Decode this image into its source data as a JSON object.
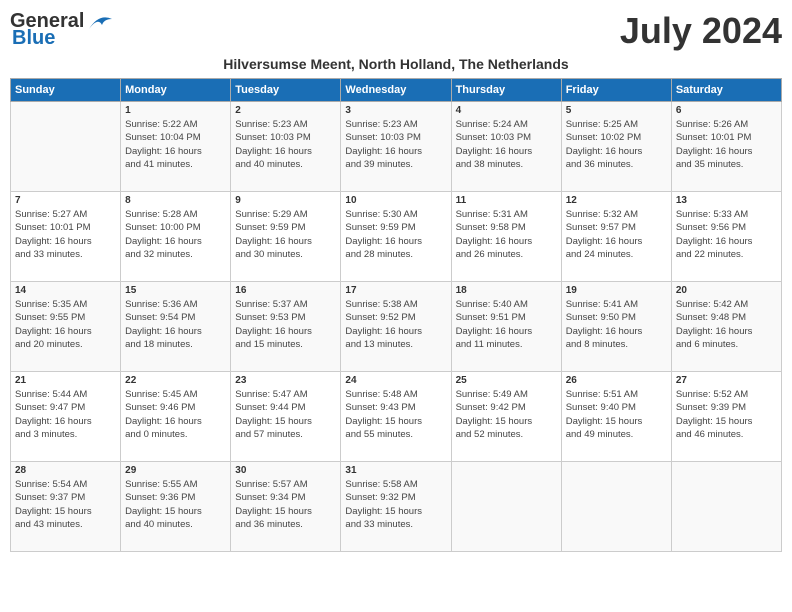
{
  "header": {
    "logo_line1": "General",
    "logo_line2": "Blue",
    "month_year": "July 2024",
    "location": "Hilversumse Meent, North Holland, The Netherlands"
  },
  "days_of_week": [
    "Sunday",
    "Monday",
    "Tuesday",
    "Wednesday",
    "Thursday",
    "Friday",
    "Saturday"
  ],
  "weeks": [
    [
      {
        "day": "",
        "info": ""
      },
      {
        "day": "1",
        "info": "Sunrise: 5:22 AM\nSunset: 10:04 PM\nDaylight: 16 hours\nand 41 minutes."
      },
      {
        "day": "2",
        "info": "Sunrise: 5:23 AM\nSunset: 10:03 PM\nDaylight: 16 hours\nand 40 minutes."
      },
      {
        "day": "3",
        "info": "Sunrise: 5:23 AM\nSunset: 10:03 PM\nDaylight: 16 hours\nand 39 minutes."
      },
      {
        "day": "4",
        "info": "Sunrise: 5:24 AM\nSunset: 10:03 PM\nDaylight: 16 hours\nand 38 minutes."
      },
      {
        "day": "5",
        "info": "Sunrise: 5:25 AM\nSunset: 10:02 PM\nDaylight: 16 hours\nand 36 minutes."
      },
      {
        "day": "6",
        "info": "Sunrise: 5:26 AM\nSunset: 10:01 PM\nDaylight: 16 hours\nand 35 minutes."
      }
    ],
    [
      {
        "day": "7",
        "info": "Sunrise: 5:27 AM\nSunset: 10:01 PM\nDaylight: 16 hours\nand 33 minutes."
      },
      {
        "day": "8",
        "info": "Sunrise: 5:28 AM\nSunset: 10:00 PM\nDaylight: 16 hours\nand 32 minutes."
      },
      {
        "day": "9",
        "info": "Sunrise: 5:29 AM\nSunset: 9:59 PM\nDaylight: 16 hours\nand 30 minutes."
      },
      {
        "day": "10",
        "info": "Sunrise: 5:30 AM\nSunset: 9:59 PM\nDaylight: 16 hours\nand 28 minutes."
      },
      {
        "day": "11",
        "info": "Sunrise: 5:31 AM\nSunset: 9:58 PM\nDaylight: 16 hours\nand 26 minutes."
      },
      {
        "day": "12",
        "info": "Sunrise: 5:32 AM\nSunset: 9:57 PM\nDaylight: 16 hours\nand 24 minutes."
      },
      {
        "day": "13",
        "info": "Sunrise: 5:33 AM\nSunset: 9:56 PM\nDaylight: 16 hours\nand 22 minutes."
      }
    ],
    [
      {
        "day": "14",
        "info": "Sunrise: 5:35 AM\nSunset: 9:55 PM\nDaylight: 16 hours\nand 20 minutes."
      },
      {
        "day": "15",
        "info": "Sunrise: 5:36 AM\nSunset: 9:54 PM\nDaylight: 16 hours\nand 18 minutes."
      },
      {
        "day": "16",
        "info": "Sunrise: 5:37 AM\nSunset: 9:53 PM\nDaylight: 16 hours\nand 15 minutes."
      },
      {
        "day": "17",
        "info": "Sunrise: 5:38 AM\nSunset: 9:52 PM\nDaylight: 16 hours\nand 13 minutes."
      },
      {
        "day": "18",
        "info": "Sunrise: 5:40 AM\nSunset: 9:51 PM\nDaylight: 16 hours\nand 11 minutes."
      },
      {
        "day": "19",
        "info": "Sunrise: 5:41 AM\nSunset: 9:50 PM\nDaylight: 16 hours\nand 8 minutes."
      },
      {
        "day": "20",
        "info": "Sunrise: 5:42 AM\nSunset: 9:48 PM\nDaylight: 16 hours\nand 6 minutes."
      }
    ],
    [
      {
        "day": "21",
        "info": "Sunrise: 5:44 AM\nSunset: 9:47 PM\nDaylight: 16 hours\nand 3 minutes."
      },
      {
        "day": "22",
        "info": "Sunrise: 5:45 AM\nSunset: 9:46 PM\nDaylight: 16 hours\nand 0 minutes."
      },
      {
        "day": "23",
        "info": "Sunrise: 5:47 AM\nSunset: 9:44 PM\nDaylight: 15 hours\nand 57 minutes."
      },
      {
        "day": "24",
        "info": "Sunrise: 5:48 AM\nSunset: 9:43 PM\nDaylight: 15 hours\nand 55 minutes."
      },
      {
        "day": "25",
        "info": "Sunrise: 5:49 AM\nSunset: 9:42 PM\nDaylight: 15 hours\nand 52 minutes."
      },
      {
        "day": "26",
        "info": "Sunrise: 5:51 AM\nSunset: 9:40 PM\nDaylight: 15 hours\nand 49 minutes."
      },
      {
        "day": "27",
        "info": "Sunrise: 5:52 AM\nSunset: 9:39 PM\nDaylight: 15 hours\nand 46 minutes."
      }
    ],
    [
      {
        "day": "28",
        "info": "Sunrise: 5:54 AM\nSunset: 9:37 PM\nDaylight: 15 hours\nand 43 minutes."
      },
      {
        "day": "29",
        "info": "Sunrise: 5:55 AM\nSunset: 9:36 PM\nDaylight: 15 hours\nand 40 minutes."
      },
      {
        "day": "30",
        "info": "Sunrise: 5:57 AM\nSunset: 9:34 PM\nDaylight: 15 hours\nand 36 minutes."
      },
      {
        "day": "31",
        "info": "Sunrise: 5:58 AM\nSunset: 9:32 PM\nDaylight: 15 hours\nand 33 minutes."
      },
      {
        "day": "",
        "info": ""
      },
      {
        "day": "",
        "info": ""
      },
      {
        "day": "",
        "info": ""
      }
    ]
  ]
}
